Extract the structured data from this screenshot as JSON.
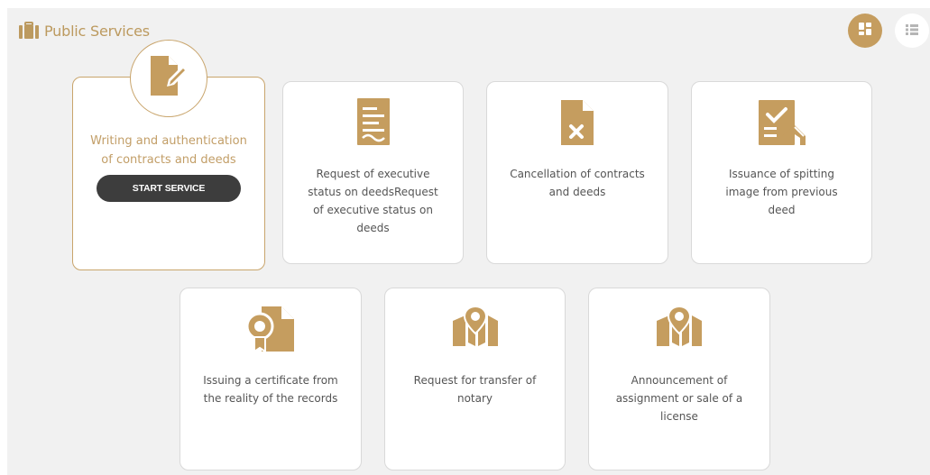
{
  "header": {
    "title": "Public Services"
  },
  "view_toggle": {
    "active": "grid"
  },
  "colors": {
    "accent": "#c59d5f",
    "card_border_active": "#c9a56c",
    "button_dark": "#3d3d3d"
  },
  "active_service": {
    "label": "Writing and authentication of contracts and deeds",
    "button_label": "START SERVICE"
  },
  "services": [
    {
      "label": "Request of executive status on deedsRequest of executive status on deeds",
      "icon": "document-lines-icon"
    },
    {
      "label": "Cancellation of contracts and deeds",
      "icon": "document-cancel-icon"
    },
    {
      "label": "Issuance of spitting image from previous deed",
      "icon": "document-check-icon"
    },
    {
      "label": "Issuing a certificate from the reality of the records",
      "icon": "certificate-icon"
    },
    {
      "label": "Request for transfer of notary",
      "icon": "map-pin-icon"
    },
    {
      "label": "Announcement of assignment or sale of a license",
      "icon": "map-pin-icon"
    }
  ]
}
